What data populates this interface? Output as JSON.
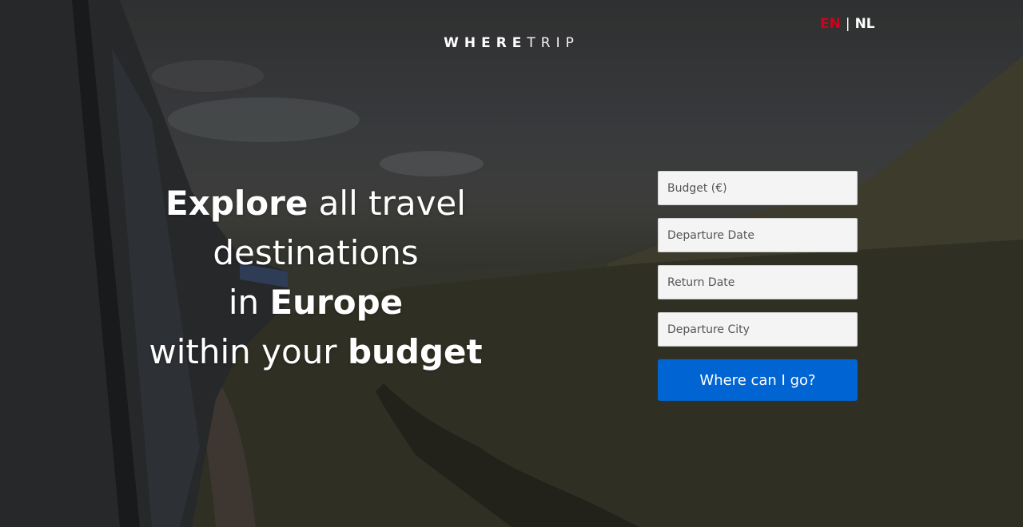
{
  "brand": {
    "bold": "WHERE",
    "light": "TRIP"
  },
  "language": {
    "active": "EN",
    "separator": "|",
    "other": "NL",
    "active_color": "#d0021b"
  },
  "headline": {
    "line1_bold": "Explore",
    "line1_rest": " all travel",
    "line2": "destinations",
    "line3_pre": "in ",
    "line3_bold": "Europe",
    "line4_pre": "within your ",
    "line4_bold": "budget"
  },
  "form": {
    "budget_placeholder": "Budget (€)",
    "departure_date_placeholder": "Departure Date",
    "return_date_placeholder": "Return Date",
    "departure_city_placeholder": "Departure City",
    "submit_label": "Where can I go?",
    "submit_color": "#0064d2"
  }
}
